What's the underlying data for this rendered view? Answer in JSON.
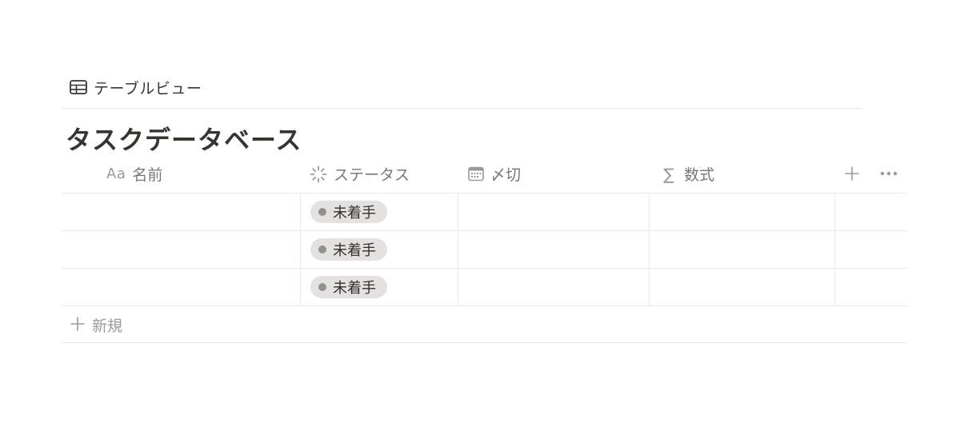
{
  "view": {
    "tab_label": "テーブルビュー"
  },
  "database": {
    "title": "タスクデータベース"
  },
  "columns": {
    "name": {
      "prefix": "Aa",
      "label": "名前"
    },
    "status": {
      "label": "ステータス"
    },
    "date": {
      "label": "〆切"
    },
    "formula": {
      "icon_text": "∑",
      "label": "数式"
    }
  },
  "rows": [
    {
      "name": "",
      "status": "未着手",
      "date": "",
      "formula": ""
    },
    {
      "name": "",
      "status": "未着手",
      "date": "",
      "formula": ""
    },
    {
      "name": "",
      "status": "未着手",
      "date": "",
      "formula": ""
    }
  ],
  "new_row_label": "新規",
  "icons": {
    "view": "table-icon",
    "status": "loading-spinner-icon",
    "date": "calendar-icon",
    "formula": "sigma-icon",
    "add": "plus-icon",
    "more": "more-horizontal-icon"
  },
  "colors": {
    "text": "#37352f",
    "muted": "#787774",
    "border": "#e9e9e7",
    "pill_bg": "#e3e2e0",
    "pill_dot": "#91918e"
  }
}
